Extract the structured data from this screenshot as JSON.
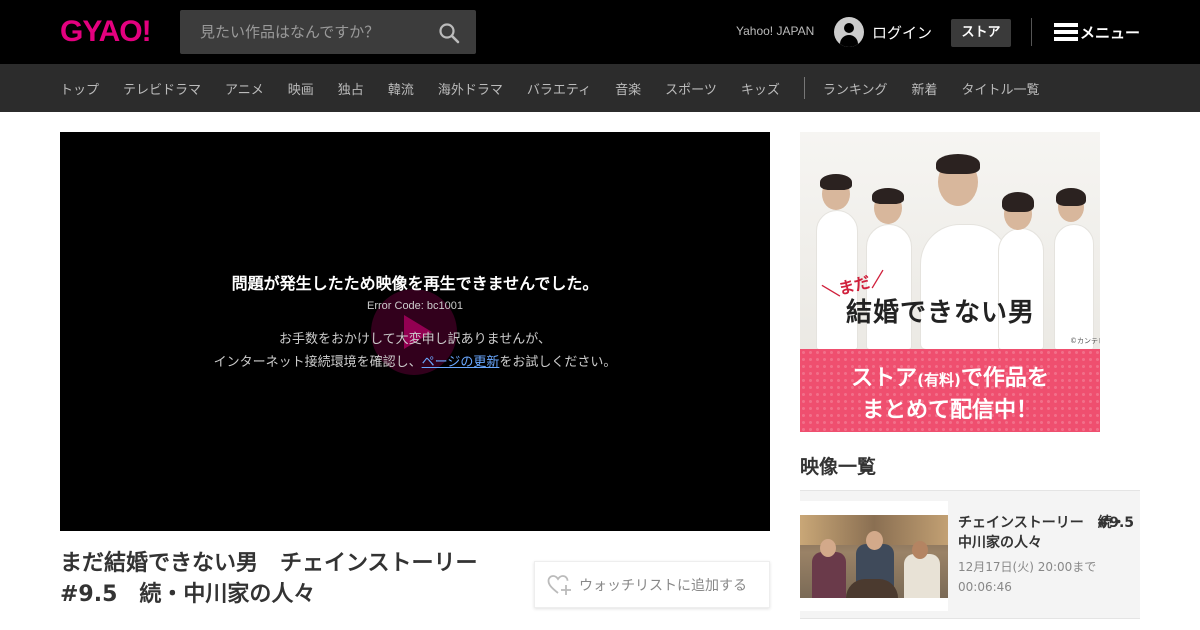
{
  "header": {
    "logo": "GYAO!",
    "search_placeholder": "見たい作品はなんですか？",
    "search_icon": "search-icon",
    "yahoo_link": "Yahoo! JAPAN",
    "login_label": "ログイン",
    "store_label": "ストア",
    "menu_label": "メニュー",
    "brand_color": "#e4007f"
  },
  "category_nav": {
    "items": [
      "トップ",
      "テレビドラマ",
      "アニメ",
      "映画",
      "独占",
      "韓流",
      "海外ドラマ",
      "バラエティ",
      "音楽",
      "スポーツ",
      "キッズ"
    ],
    "extra_items": [
      "ランキング",
      "新着",
      "タイトル一覧"
    ]
  },
  "player": {
    "error_title": "問題が発生したため映像を再生できませんでした。",
    "error_code": "Error Code: bc1001",
    "message_line1": "お手数をおかけして大変申し訳ありませんが、",
    "message_line2_before": "インターネット接続環境を確認し、",
    "message_link": "ページの更新",
    "message_line2_after": "をお試しください。"
  },
  "episode": {
    "title": "まだ結婚できない男　チェインストーリー　#9.5　続・中川家の人々",
    "watchlist_label": "ウォッチリストに追加する"
  },
  "banner": {
    "mada": "＼まだ／",
    "show_title": "結婚できない男",
    "credit": "©カンテレ",
    "line1_a": "ストア",
    "line1_small": "(有料)",
    "line1_b": "で作品を",
    "line2": "まとめて配信中！"
  },
  "video_list": {
    "heading": "映像一覧",
    "items": [
      {
        "title": "チェインストーリー　続・中川家の人々",
        "episode": "#9.5",
        "available_until": "12月17日(火) 20:00まで",
        "duration": "00:06:46"
      }
    ]
  }
}
